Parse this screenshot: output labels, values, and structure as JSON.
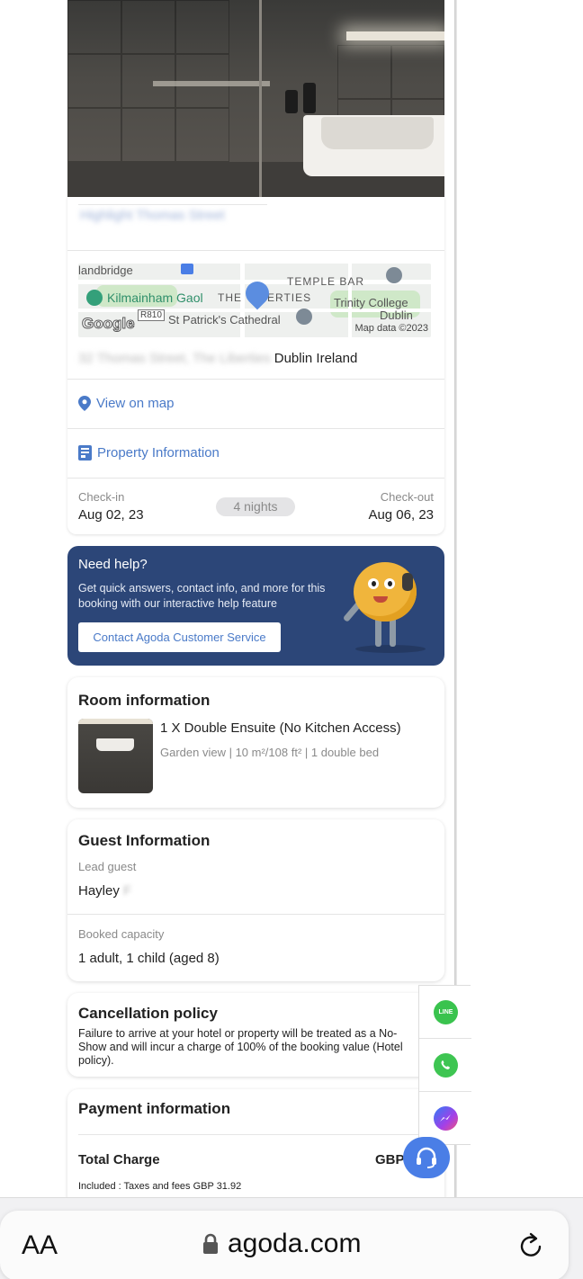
{
  "property": {
    "address_suffix": "Dublin Ireland",
    "address_blurred": "32 Thomas Street, The Liberties",
    "name_blurred": "Highlight Thomas Street"
  },
  "map": {
    "labels": {
      "landbridge": "landbridge",
      "kilmainham": "Kilmainham Gaol",
      "the": "THE",
      "liberties": "ERTIES",
      "temple_bar": "TEMPLE BAR",
      "trinity": "Trinity College",
      "dublin": "Dublin",
      "stpatricks": "St Patrick's Cathedral",
      "road": "R810",
      "google": "Google",
      "mapdata": "Map data ©2023"
    }
  },
  "links": {
    "view_on_map": "View on map",
    "property_information": "Property Information"
  },
  "stay": {
    "checkin_label": "Check-in",
    "checkin_date": "Aug 02, 23",
    "nights": "4 nights",
    "checkout_label": "Check-out",
    "checkout_date": "Aug 06, 23"
  },
  "help": {
    "title": "Need help?",
    "text": "Get quick answers, contact info, and more for this booking with our interactive help feature",
    "button": "Contact Agoda Customer Service"
  },
  "room": {
    "title": "Room information",
    "name": "1 X Double Ensuite (No Kitchen Access)",
    "details": "Garden view | 10 m²/108 ft² | 1 double bed"
  },
  "guest": {
    "title": "Guest Information",
    "lead_label": "Lead guest",
    "lead_name": "Hayley",
    "lead_surname_blurred": "F",
    "capacity_label": "Booked capacity",
    "capacity": "1 adult, 1 child (aged 8)"
  },
  "cancellation": {
    "title": "Cancellation policy",
    "text": "Failure to arrive at your hotel or property will be treated as a No-Show and will incur a charge of 100% of the booking value (Hotel policy)."
  },
  "payment": {
    "title": "Payment information",
    "total_label": "Total Charge",
    "currency": "GBP",
    "included": "Included : Taxes and fees GBP 31.92"
  },
  "chat": {
    "line": "LINE"
  },
  "browser": {
    "aa": "AA",
    "domain": "agoda.com"
  },
  "colors": {
    "accent": "#4a7ac8",
    "banner": "#2c4678",
    "line_green": "#3ac34e",
    "whatsapp": "#3ec552",
    "fab": "#4a7ee6"
  }
}
